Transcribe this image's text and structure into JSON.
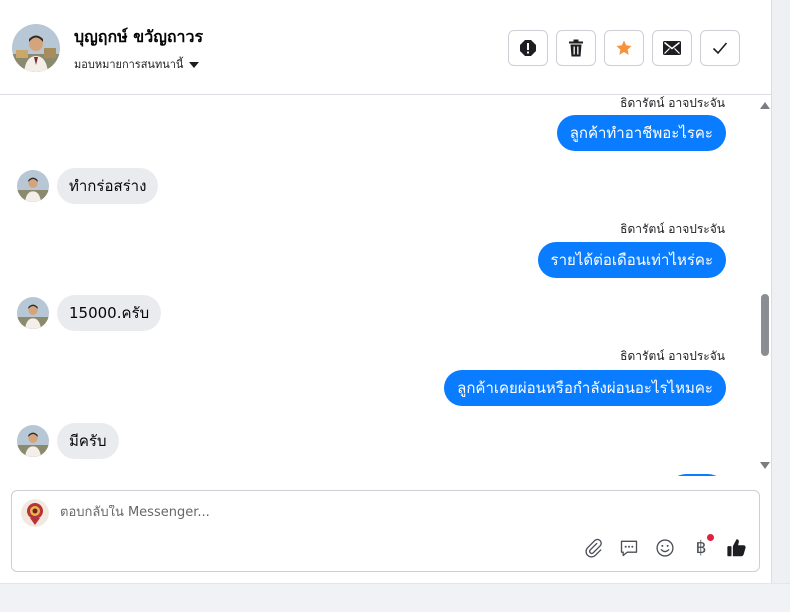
{
  "contact": {
    "name": "บุญฤกษ์ ขวัญถาวร",
    "assign_label": "มอบหมายการสนทนานี้"
  },
  "actions": [
    {
      "name": "report-spam-button",
      "icon": "alert-icon"
    },
    {
      "name": "delete-button",
      "icon": "trash-icon"
    },
    {
      "name": "star-button",
      "icon": "star-icon",
      "color": "#f7923a"
    },
    {
      "name": "mark-unread-button",
      "icon": "envelope-icon"
    },
    {
      "name": "mark-done-button",
      "icon": "check-icon"
    }
  ],
  "messages": [
    {
      "sender": "ธิดารัตน์ อาจประจัน",
      "text": "ลูกค้าทำอาชีพอะไรคะ"
    },
    {
      "text": "ทำกร่อสร่าง"
    },
    {
      "sender": "ธิดารัตน์ อาจประจัน",
      "text": "รายได้ต่อเดือนเท่าไหร่คะ"
    },
    {
      "text": "15000.ครับ"
    },
    {
      "sender": "ธิดารัตน์ อาจประจัน",
      "text": "ลูกค้าเคยผ่อนหรือกำลังผ่อนอะไรไหมคะ"
    },
    {
      "text": "มีครับ"
    }
  ],
  "composer": {
    "placeholder": "ตอบกลับใน Messenger...",
    "tools": [
      "paperclip-icon",
      "saved-reply-icon",
      "emoji-icon",
      "baht-payment-icon",
      "thumbs-up-icon"
    ],
    "payment_symbol": "฿"
  },
  "colors": {
    "outgoing_bubble": "#0a7cff",
    "incoming_bubble": "#eaebee",
    "notification_dot": "#e41e3f"
  }
}
